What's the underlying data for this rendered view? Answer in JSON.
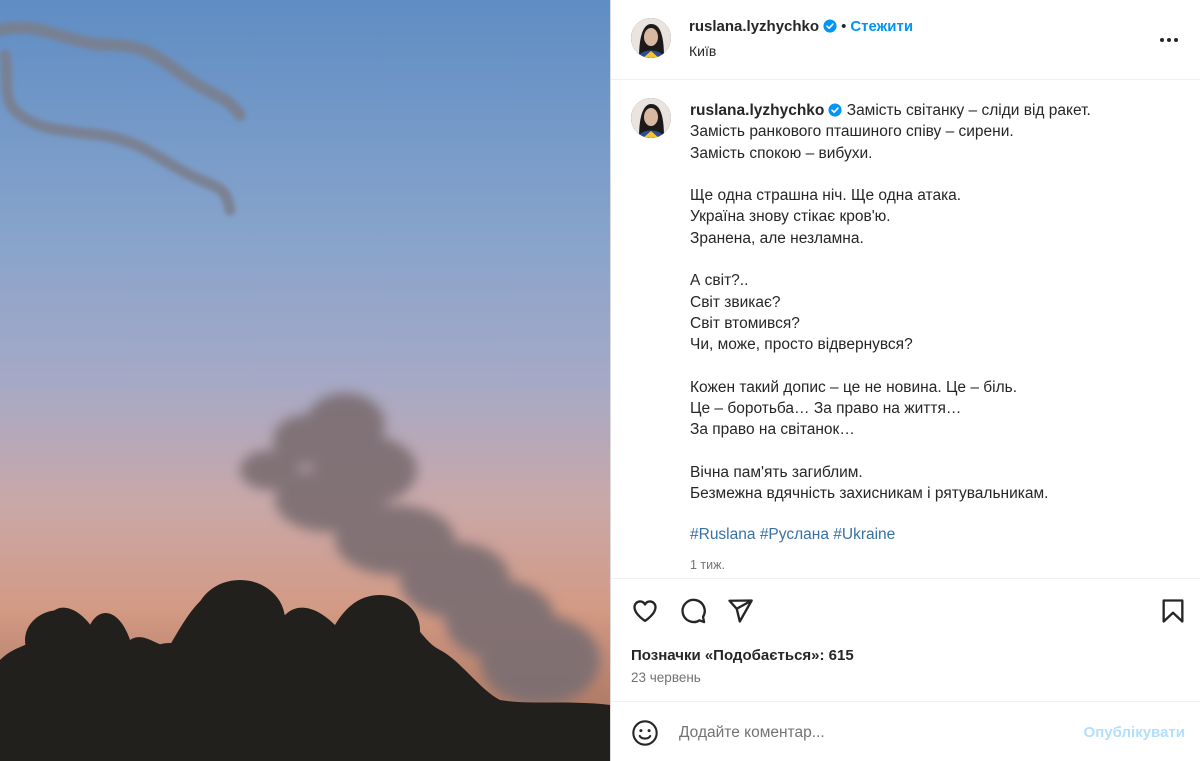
{
  "post": {
    "username": "ruslana.lyzhychko",
    "follow_label": "Стежити",
    "dot": "•",
    "location": "Київ",
    "more_icon": "more-horizontal-icon",
    "verified_icon": "verified-badge-icon"
  },
  "caption": {
    "username": "ruslana.lyzhychko",
    "lines": [
      "Замість світанку – сліди від ракет.",
      "Замість ранкового пташиного співу – сирени.",
      "Замість спокою – вибухи.",
      "",
      "Ще одна страшна ніч. Ще одна атака.",
      "Україна знову стікає кров'ю.",
      "Зранена, але незламна.",
      "",
      "А світ?..",
      "Світ звикає?",
      "Світ втомився?",
      "Чи, може, просто відвернувся?",
      "",
      "Кожен такий допис – це не новина. Це – біль.",
      "Це – боротьба… За право на життя…",
      "За право на світанок…",
      "",
      "Вічна пам'ять загиблим.",
      "Безмежна вдячність захисникам і рятувальникам."
    ],
    "hashtags": [
      "#Ruslana",
      "#Руслана",
      "#Ukraine"
    ],
    "time_ago": "1 тиж."
  },
  "actions": {
    "like_icon": "heart-icon",
    "comment_icon": "comment-icon",
    "share_icon": "share-paper-plane-icon",
    "save_icon": "bookmark-icon",
    "likes_text": "Позначки «Подобається»: 615",
    "date": "23 червень"
  },
  "comment": {
    "emoji_icon": "emoji-icon",
    "placeholder": "Додайте коментар...",
    "publish_label": "Опублікувати"
  },
  "colors": {
    "accent": "#0095f6",
    "publish_disabled": "#b2dffc",
    "hashtag": "#3871a5",
    "secondary_text": "#737373"
  }
}
